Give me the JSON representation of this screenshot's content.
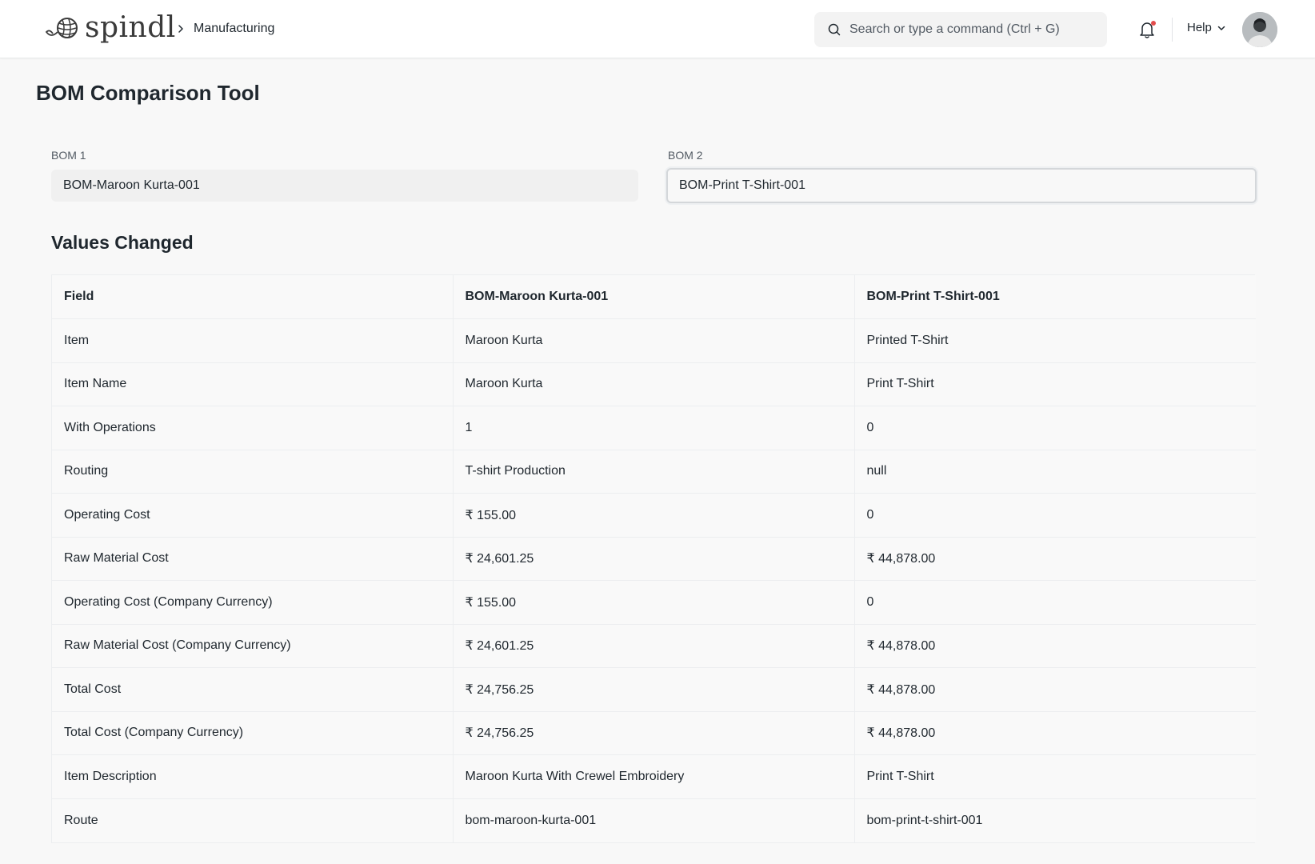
{
  "app": {
    "brand": "spindl",
    "breadcrumb": "Manufacturing"
  },
  "search": {
    "placeholder": "Search or type a command (Ctrl + G)"
  },
  "header": {
    "help_label": "Help"
  },
  "page": {
    "title": "BOM Comparison Tool"
  },
  "form": {
    "bom1_label": "BOM 1",
    "bom1_value": "BOM-Maroon Kurta-001",
    "bom2_label": "BOM 2",
    "bom2_value": "BOM-Print T-Shirt-001"
  },
  "section": {
    "title": "Values Changed"
  },
  "table": {
    "headers": [
      "Field",
      "BOM-Maroon Kurta-001",
      "BOM-Print T-Shirt-001"
    ],
    "rows": [
      [
        "Item",
        "Maroon Kurta",
        "Printed T-Shirt"
      ],
      [
        "Item Name",
        "Maroon Kurta",
        "Print T-Shirt"
      ],
      [
        "With Operations",
        "1",
        "0"
      ],
      [
        "Routing",
        "T-shirt Production",
        "null"
      ],
      [
        "Operating Cost",
        "₹ 155.00",
        "0"
      ],
      [
        "Raw Material Cost",
        "₹ 24,601.25",
        "₹ 44,878.00"
      ],
      [
        "Operating Cost (Company Currency)",
        "₹ 155.00",
        "0"
      ],
      [
        "Raw Material Cost (Company Currency)",
        "₹ 24,601.25",
        "₹ 44,878.00"
      ],
      [
        "Total Cost",
        "₹ 24,756.25",
        "₹ 44,878.00"
      ],
      [
        "Total Cost (Company Currency)",
        "₹ 24,756.25",
        "₹ 44,878.00"
      ],
      [
        "Item Description",
        "Maroon Kurta With Crewel Embroidery",
        "Print T-Shirt"
      ],
      [
        "Route",
        "bom-maroon-kurta-001",
        "bom-print-t-shirt-001"
      ]
    ]
  },
  "colors": {
    "accent_notification": "#e24c4c",
    "text": "#1f272e",
    "background": "#f8f8f8"
  },
  "icons": [
    "yarn-ball-logo-icon",
    "chevron-right-icon",
    "search-icon",
    "bell-icon",
    "chevron-down-icon"
  ]
}
